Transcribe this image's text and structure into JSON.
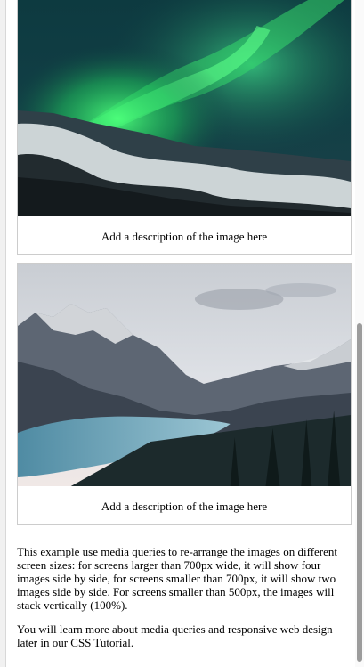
{
  "gallery": {
    "items": [
      {
        "image": "aurora-borealis-photo",
        "description": "Add a description of the image here"
      },
      {
        "image": "mountain-lake-photo",
        "description": "Add a description of the image here"
      }
    ]
  },
  "content": {
    "paragraph_1": "This example use media queries to re-arrange the images on different screen sizes: for screens larger than 700px wide, it will show four images side by side, for screens smaller than 700px, it will show two images side by side. For screens smaller than 500px, the images will stack vertically (100%).",
    "paragraph_2": "You will learn more about media queries and responsive web design later in our CSS Tutorial."
  },
  "colors": {
    "border": "#cccccc",
    "scroll_thumb": "#9c9c9c"
  }
}
